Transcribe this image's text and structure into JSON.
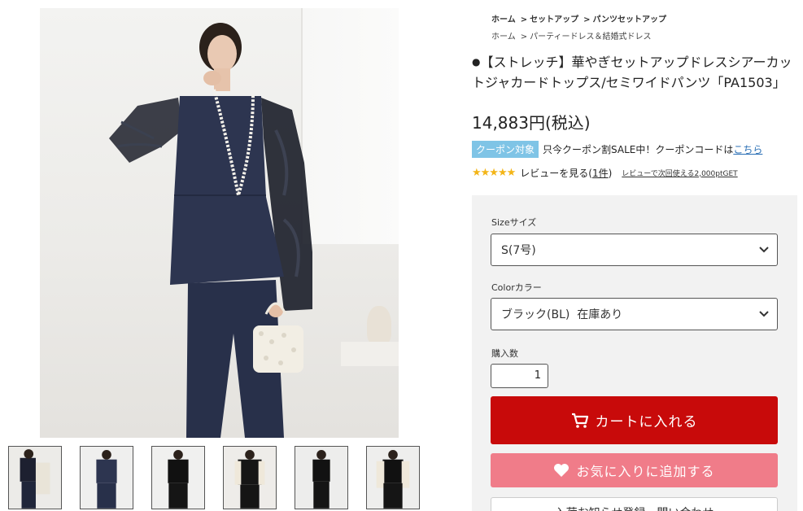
{
  "breadcrumb": {
    "row1": [
      "ホーム",
      "セットアップ",
      "パンツセットアップ"
    ],
    "row2": [
      "ホーム",
      "パーティードレス＆結婚式ドレス"
    ],
    "separator": ">"
  },
  "product": {
    "bullet": "●",
    "title": "【ストレッチ】華やぎセットアップドレスシアーカットジャカードトップス/セミワイドパンツ「PA1503」",
    "price": "14,883円(税込)"
  },
  "coupon": {
    "badge": "クーポン対象",
    "text": "只今クーポン割SALE中！クーポンコードは",
    "link": "こちら"
  },
  "review": {
    "stars": "★★★★★",
    "rating": 5,
    "link_prefix": "レビューを見る(",
    "count": "1件",
    "link_suffix": ")",
    "point_text": "レビューで次回使える2,000ptGET"
  },
  "form": {
    "size_label": "Sizeサイズ",
    "size_value": "S(7号)",
    "color_label": "Colorカラー",
    "color_value": "ブラック(BL)  在庫あり",
    "qty_label": "購入数",
    "qty_value": "1"
  },
  "buttons": {
    "cart": "カートに入れる",
    "favorite": "お気に入りに追加する",
    "next": "入荷お知らせ登録・問い合わせ"
  },
  "colors": {
    "cart": "#c80a0a",
    "favorite": "#f07c89",
    "coupon_badge": "#7fc4e6",
    "star": "#f3b518",
    "navy": "#26304a"
  },
  "icons": {
    "cart": "cart-icon",
    "favorite": "heart-icon",
    "select": "chevron-down-icon"
  }
}
